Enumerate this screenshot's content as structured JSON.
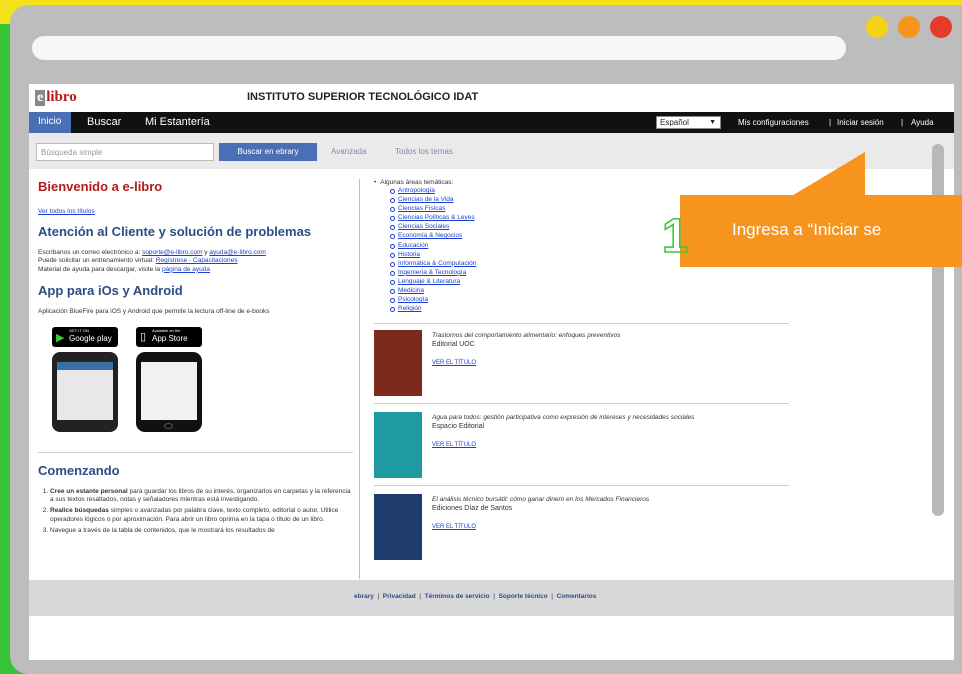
{
  "header": {
    "logo_text": "libro",
    "logo_letter": "e",
    "institution": "INSTITUTO SUPERIOR TECNOLÓGICO IDAT"
  },
  "nav": {
    "items": [
      "Inicio",
      "Buscar",
      "Mi Estantería"
    ],
    "language": "Español",
    "right_links": [
      "Mis configuraciones",
      "Iniciar sesión",
      "Ayuda"
    ]
  },
  "search": {
    "placeholder": "Búsqueda simple",
    "button": "Buscar en ebrary",
    "advanced": "Avanzada",
    "all_topics": "Todos los temas"
  },
  "left": {
    "welcome": "Bienvenido a e-libro",
    "all_titles": "Ver todos los títulos",
    "support_title": "Atención al Cliente y solución de problemas",
    "support_line1_a": "Escríbanos un correo electrónico a: ",
    "support_email1": "soporte@e-libro.com",
    "support_line1_b": " y ",
    "support_email2": "ayuda@e-libro.com",
    "support_line2_a": "Puede solicitar un entrenamiento virtual: ",
    "support_link2": "Regístrese - Capacitaciones",
    "support_line3_a": "Material de ayuda para descargar, visite la ",
    "support_link3": "página de ayuda",
    "app_title": "App para iOs y Android",
    "app_desc": "Aplicación BlueFire para iOS y Android que permite la lectura off-line de e-books",
    "google_play_small": "GET IT ON",
    "google_play": "Google play",
    "app_store_small": "Available on the",
    "app_store": "App Store",
    "getting_started": "Comenzando",
    "step1_bold": "Cree un estante personal",
    "step1_text": " para guardar los libros de su interés, organizarlos en carpetas y la referencia a sus textos resaltados, notas y señaladores mientras está investigando.",
    "step2_bold": "Realice búsquedas",
    "step2_text": " simples o avanzadas por palabra clave, texto completo, editorial o autor. Utilice operadores lógicos o por aproximación. Para abrir un libro oprima en la tapa o título de un libro.",
    "step3_text": "Navegue a través de la tabla de contenidos, que le mostrará los resultados de"
  },
  "right": {
    "areas_heading": "Algunas áreas temáticas:",
    "areas": [
      "Antropología",
      "Ciencias de la Vida",
      "Ciencias Físicas",
      "Ciencias Políticas & Leyes",
      "Ciencias Sociales",
      "Economía & Negocios",
      "Educación",
      "Historia",
      "Informática & Computación",
      "Ingeniería & Tecnología",
      "Lenguaje & Literatura",
      "Medicina",
      "Psicología",
      "Religión"
    ],
    "books": [
      {
        "title": "Trastornos del comportamiento alimentario: enfoques preventivos",
        "publisher": "Editorial UOC",
        "link": "VER EL TÍTULO",
        "color": "#7b2a1c"
      },
      {
        "title": "Agua para todos: gestión participativa como expresión de intereses y necesidades sociales",
        "publisher": "Espacio Editorial",
        "link": "VER EL TÍTULO",
        "color": "#1f9aa0"
      },
      {
        "title": "El análisis técnico bursátil: cómo ganar dinero en los Mercados Financieros",
        "publisher": "Ediciones Díaz de Santos",
        "link": "VER EL TÍTULO",
        "color": "#1e3b6e"
      }
    ]
  },
  "footer": {
    "brand": "ebrary",
    "links": [
      "Privacidad",
      "Términos de servicio",
      "Soporte técnico",
      "Comentarios"
    ]
  },
  "callout": {
    "number": "1",
    "text": "Ingresa a “Iniciar se"
  },
  "colors": {
    "accent_orange": "#f7941d",
    "nav_blue": "#4b6fb5",
    "title_red": "#b01c1c"
  }
}
